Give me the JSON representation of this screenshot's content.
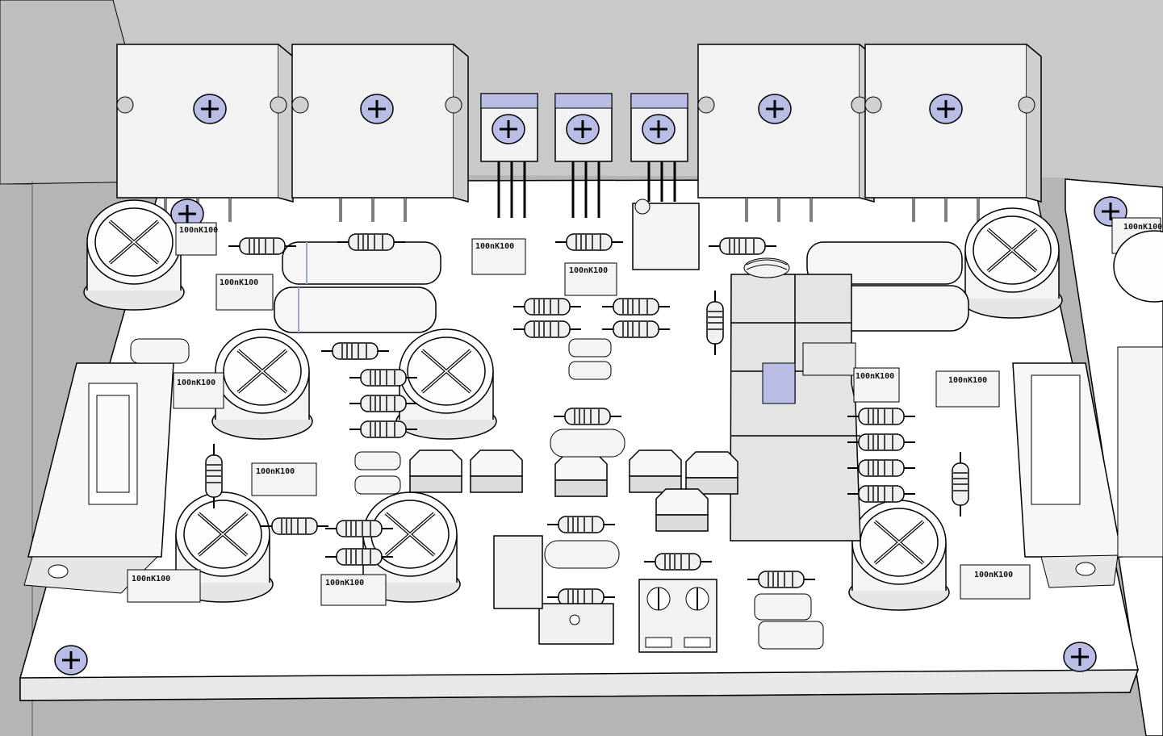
{
  "scene": {
    "background": "#b4b6b4",
    "board_color": "#ffffff",
    "edge_color": "#000000",
    "screw_color": "#b9bde6",
    "body_color": "#d8d8d8"
  },
  "capacitor_labels": {
    "c1": "100nK100",
    "c2": "100nK100",
    "c3": "100nK100",
    "c4": "100nK100",
    "c5": "100nK100",
    "c6": "100nK100",
    "c7": "100nK100",
    "c8": "100nK100",
    "c9": "100nK100",
    "c10": "100nK100",
    "c11": "100nK100",
    "c12": "100nK100"
  }
}
